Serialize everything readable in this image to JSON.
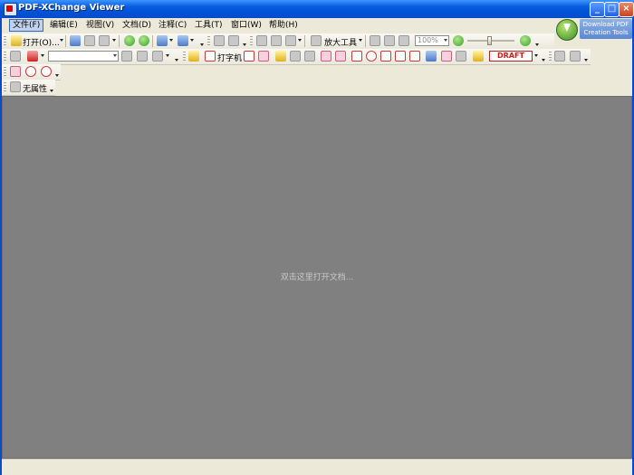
{
  "window": {
    "title": "PDF-XChange Viewer"
  },
  "menu": [
    {
      "label": "文件(F)",
      "active": true
    },
    {
      "label": "编辑(E)"
    },
    {
      "label": "视图(V)"
    },
    {
      "label": "文档(D)"
    },
    {
      "label": "注释(C)"
    },
    {
      "label": "工具(T)"
    },
    {
      "label": "窗口(W)"
    },
    {
      "label": "帮助(H)"
    }
  ],
  "promo": {
    "line1": "Download PDF",
    "line2": "Creation Tools"
  },
  "toolbar1": {
    "open_label": "打开(O)...",
    "zoom_tool_label": "放大工具",
    "zoom_value": "100%"
  },
  "toolbar2": {
    "typewriter_label": "打字机",
    "stamp_label": "DRAFT"
  },
  "toolbar4": {
    "properties_label": "无属性"
  },
  "document": {
    "hint": "双击这里打开文档..."
  },
  "colors": {
    "titlebar": "#0053d6",
    "document_bg": "#808080",
    "chrome": "#ece9d8"
  }
}
